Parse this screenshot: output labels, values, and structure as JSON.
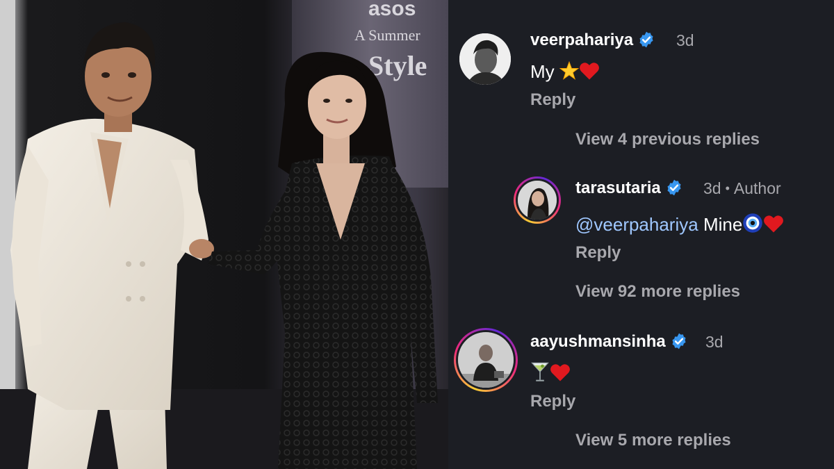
{
  "photo": {
    "backdrop_text": {
      "brand": "asos",
      "line1": "A Summer",
      "line2": "Style"
    }
  },
  "comments": [
    {
      "username": "veerpahariya",
      "verified": true,
      "time": "3d",
      "text_prefix": "My ",
      "reply_label": "Reply",
      "view_more": "View 4 previous replies"
    },
    {
      "username": "tarasutaria",
      "verified": true,
      "time": "3d",
      "author_tag": "Author",
      "mention": "@veerpahariya",
      "text": " Mine",
      "reply_label": "Reply",
      "view_more": "View 92 more replies"
    },
    {
      "username": "aayushmansinha",
      "verified": true,
      "time": "3d",
      "reply_label": "Reply",
      "view_more": "View 5 more replies"
    }
  ],
  "colors": {
    "background": "#1c1e24",
    "verified_blue": "#3897f0",
    "muted_text": "#a8a8ad",
    "mention": "#9fc7ff"
  },
  "icons": [
    "verified-badge-icon",
    "star-emoji",
    "heart-emoji",
    "nazar-emoji",
    "cocktail-emoji"
  ]
}
